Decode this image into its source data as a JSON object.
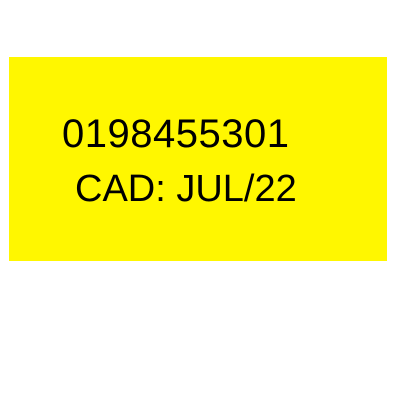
{
  "label": {
    "background_color": "#fff700",
    "code": "0198455301",
    "expiry": "CAD: JUL/22"
  }
}
